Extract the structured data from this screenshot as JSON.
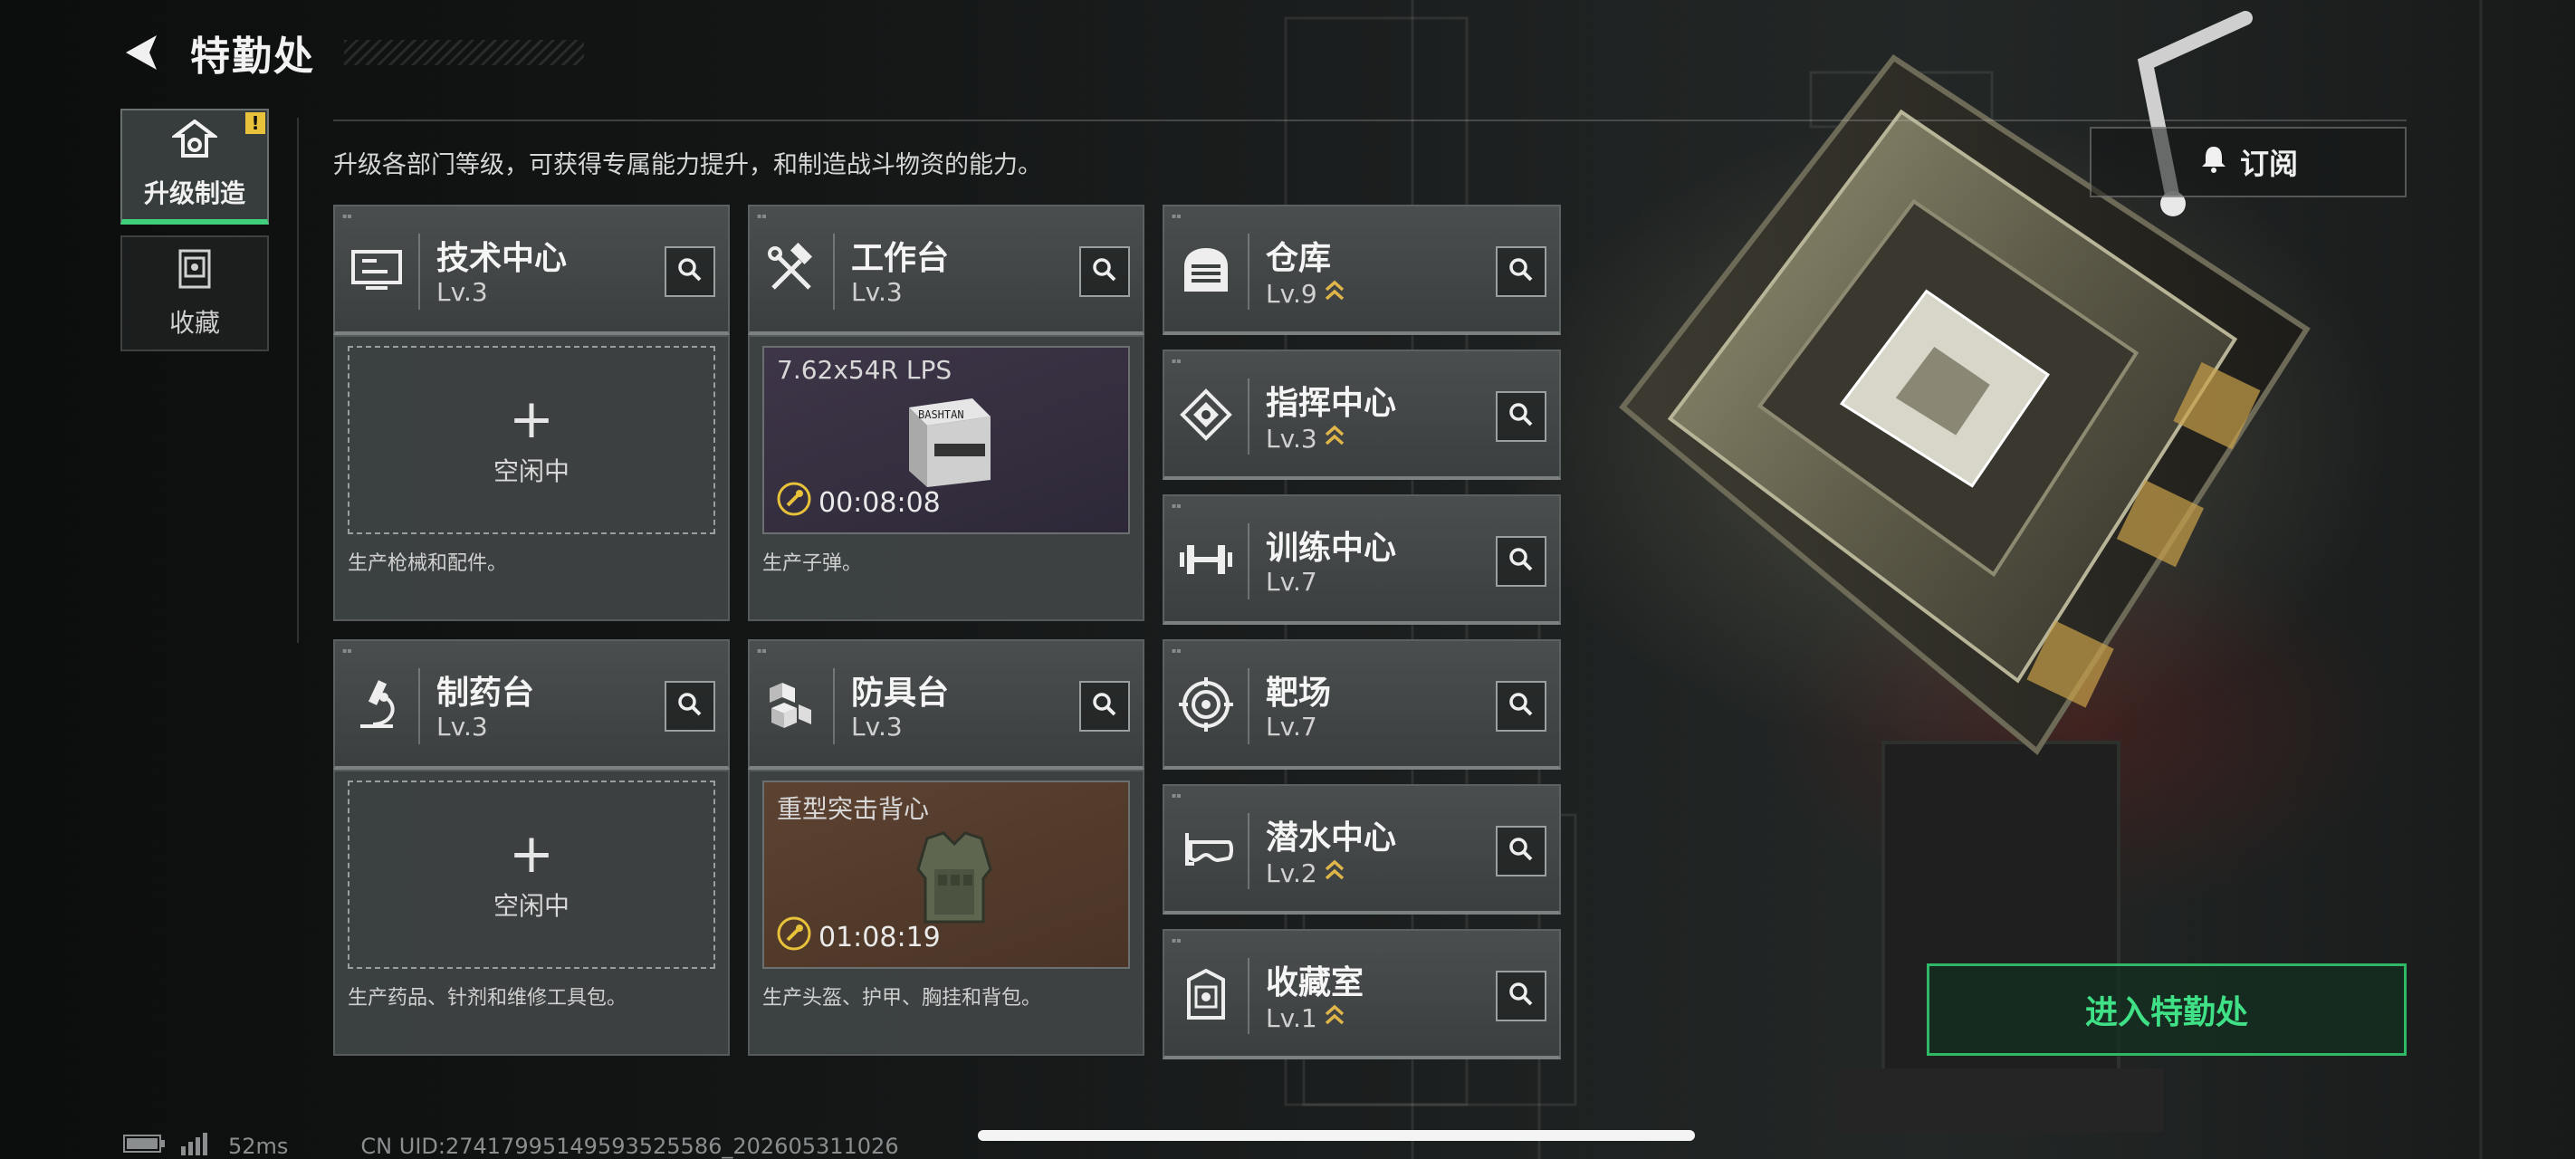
{
  "header": {
    "title": "特勤处",
    "back_icon": "back-arrow-icon"
  },
  "side_nav": [
    {
      "label": "升级制造",
      "icon": "upgrade-icon",
      "active": true,
      "badge": "!"
    },
    {
      "label": "收藏",
      "icon": "collection-icon",
      "active": false
    }
  ],
  "intro": "升级各部门等级，可获得专属能力提升，和制造战斗物资的能力。",
  "subscribe": {
    "label": "订阅",
    "icon": "bell-icon"
  },
  "departments_left": [
    {
      "name": "技术中心",
      "level": "Lv.3",
      "icon": "tech-center-icon",
      "slot": {
        "state": "idle",
        "plus": "+",
        "idle_label": "空闲中"
      },
      "desc": "生产枪械和配件。"
    },
    {
      "name": "工作台",
      "level": "Lv.3",
      "icon": "hammer-wrench-icon",
      "slot": {
        "state": "producing",
        "item": "7.62x54R LPS",
        "timer": "00:08:08",
        "box_label": "BASHTAN",
        "rarity": "purple"
      },
      "desc": "生产子弹。"
    },
    {
      "name": "制药台",
      "level": "Lv.3",
      "icon": "microscope-icon",
      "slot": {
        "state": "idle",
        "plus": "+",
        "idle_label": "空闲中"
      },
      "desc": "生产药品、针剂和维修工具包。"
    },
    {
      "name": "防具台",
      "level": "Lv.3",
      "icon": "cubes-icon",
      "slot": {
        "state": "producing",
        "item": "重型突击背心",
        "timer": "01:08:19",
        "rarity": "brown"
      },
      "desc": "生产头盔、护甲、胸挂和背包。"
    }
  ],
  "departments_right": [
    {
      "name": "仓库",
      "level": "Lv.9",
      "icon": "warehouse-icon",
      "upgradable": true
    },
    {
      "name": "指挥中心",
      "level": "Lv.3",
      "icon": "command-chip-icon",
      "upgradable": true
    },
    {
      "name": "训练中心",
      "level": "Lv.7",
      "icon": "dumbbell-icon",
      "upgradable": false
    },
    {
      "name": "靶场",
      "level": "Lv.7",
      "icon": "target-icon",
      "upgradable": false
    },
    {
      "name": "潜水中心",
      "level": "Lv.2",
      "icon": "diving-mask-icon",
      "upgradable": true
    },
    {
      "name": "收藏室",
      "level": "Lv.1",
      "icon": "collection-room-icon",
      "upgradable": true
    }
  ],
  "enter_button": "进入特勤处",
  "status": {
    "ping": "52ms",
    "uid": "CN UID:2741799514959352​5586_202605311026"
  },
  "colors": {
    "accent_green": "#3fe086",
    "badge_yellow": "#e8c23a",
    "upgrade_chevron": "#e0b64a"
  }
}
